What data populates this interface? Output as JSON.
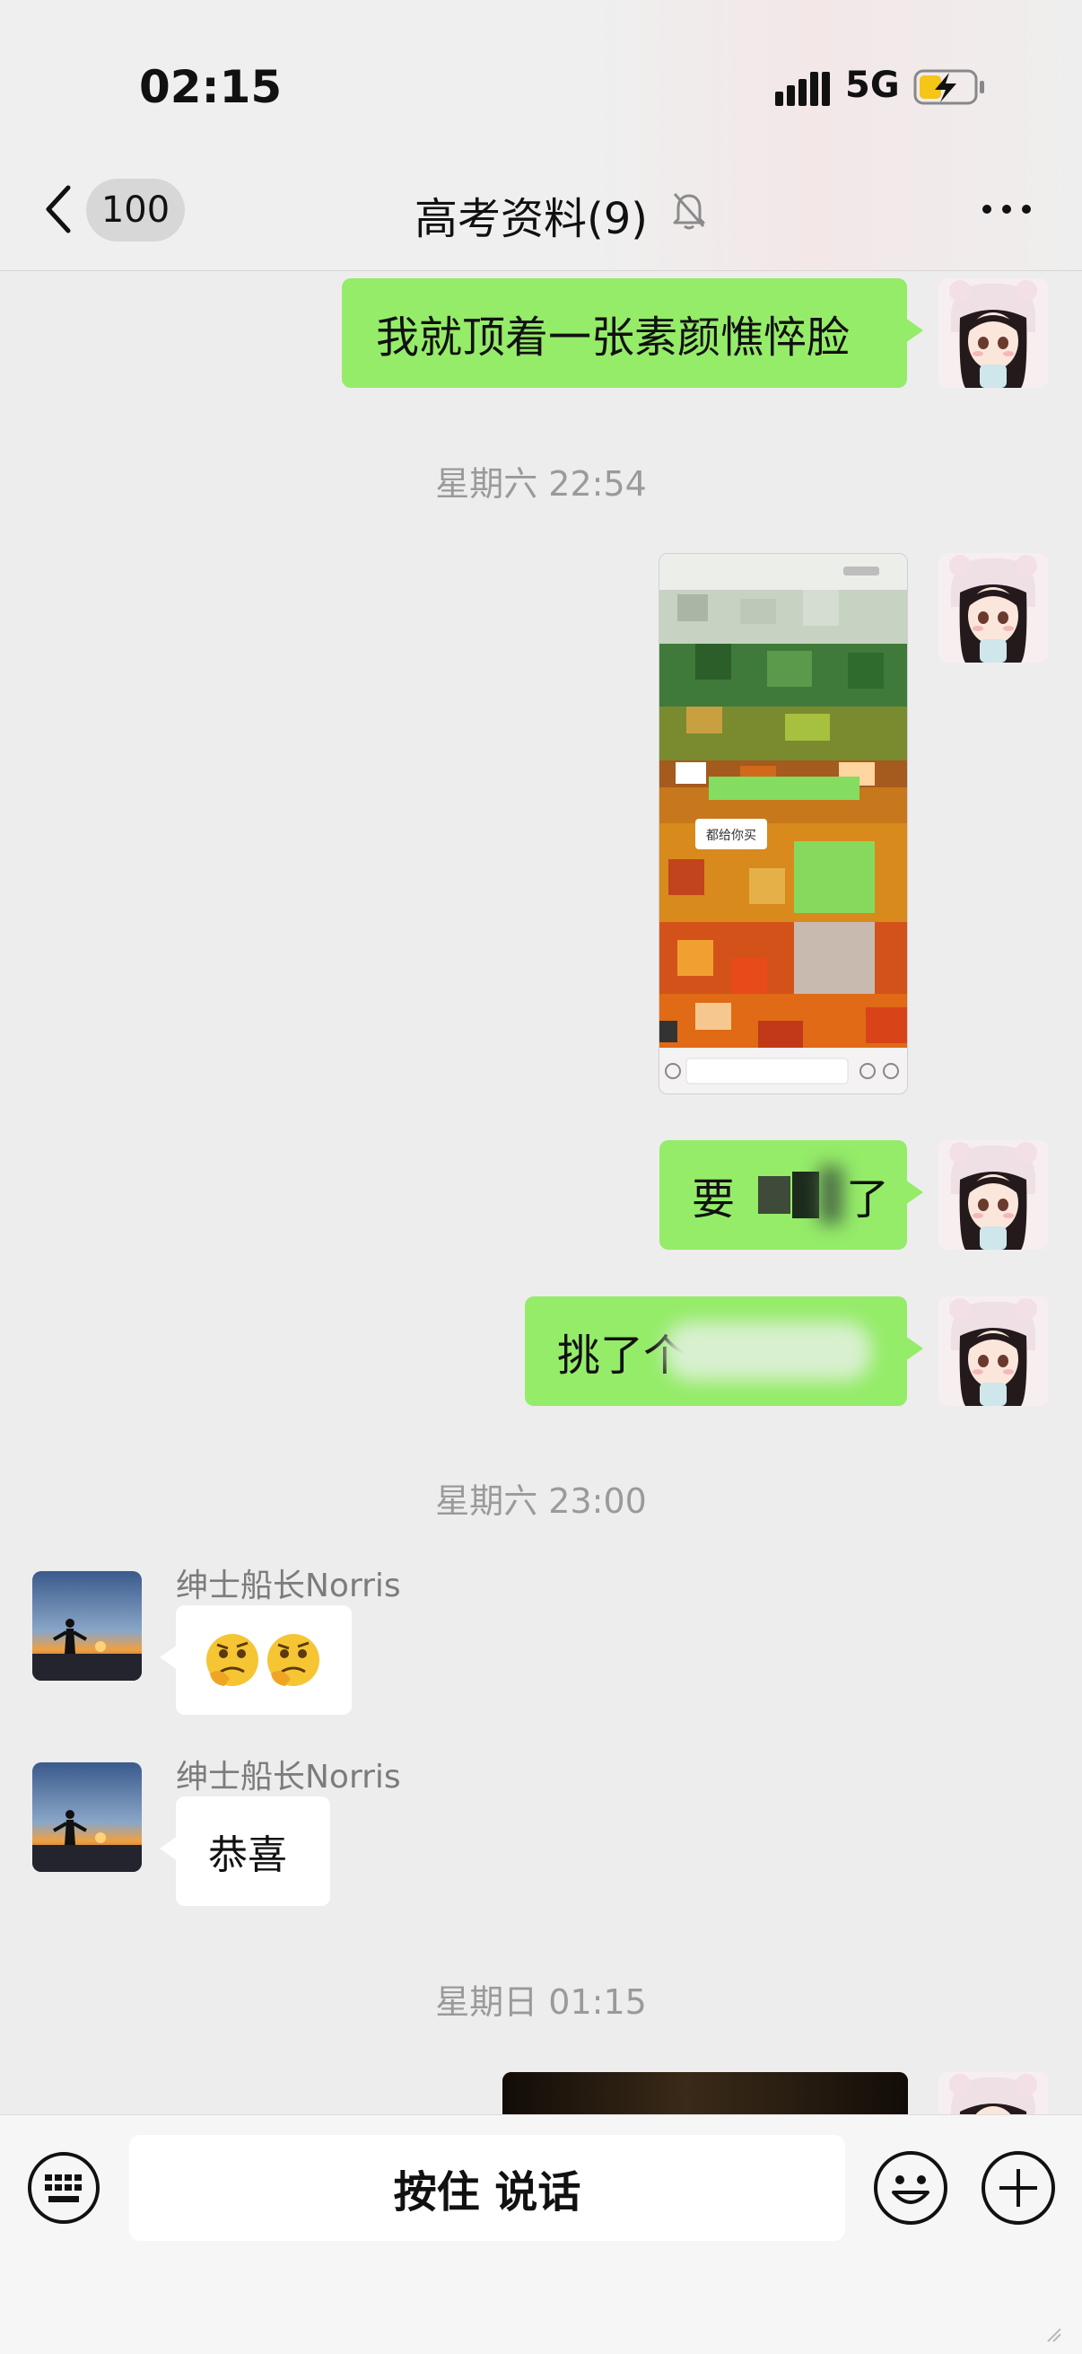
{
  "status_bar": {
    "time": "02:15",
    "network": "5G"
  },
  "header": {
    "back_count": "100",
    "title": "高考资料(9)"
  },
  "messages": {
    "m1": "我就顶着一张素颜憔悴脸",
    "ts1": "星期六 22:54",
    "shot_tag": "都给你买",
    "m3": "要",
    "m3b": "了",
    "m4": "挑了个",
    "ts2": "星期六 23:00",
    "sender1": "绅士船长Norris",
    "sender2": "绅士船长Norris",
    "m6": "恭喜",
    "ts3": "星期日 01:15"
  },
  "input_bar": {
    "talk_label": "按住 说话"
  },
  "colors": {
    "sent_bubble": "#95ec69",
    "received_bubble": "#ffffff",
    "background": "#ededed"
  },
  "icons": [
    "chevron-left-icon",
    "mute-bell-icon",
    "more-dots-icon",
    "keyboard-icon",
    "emoji-icon",
    "plus-icon"
  ]
}
